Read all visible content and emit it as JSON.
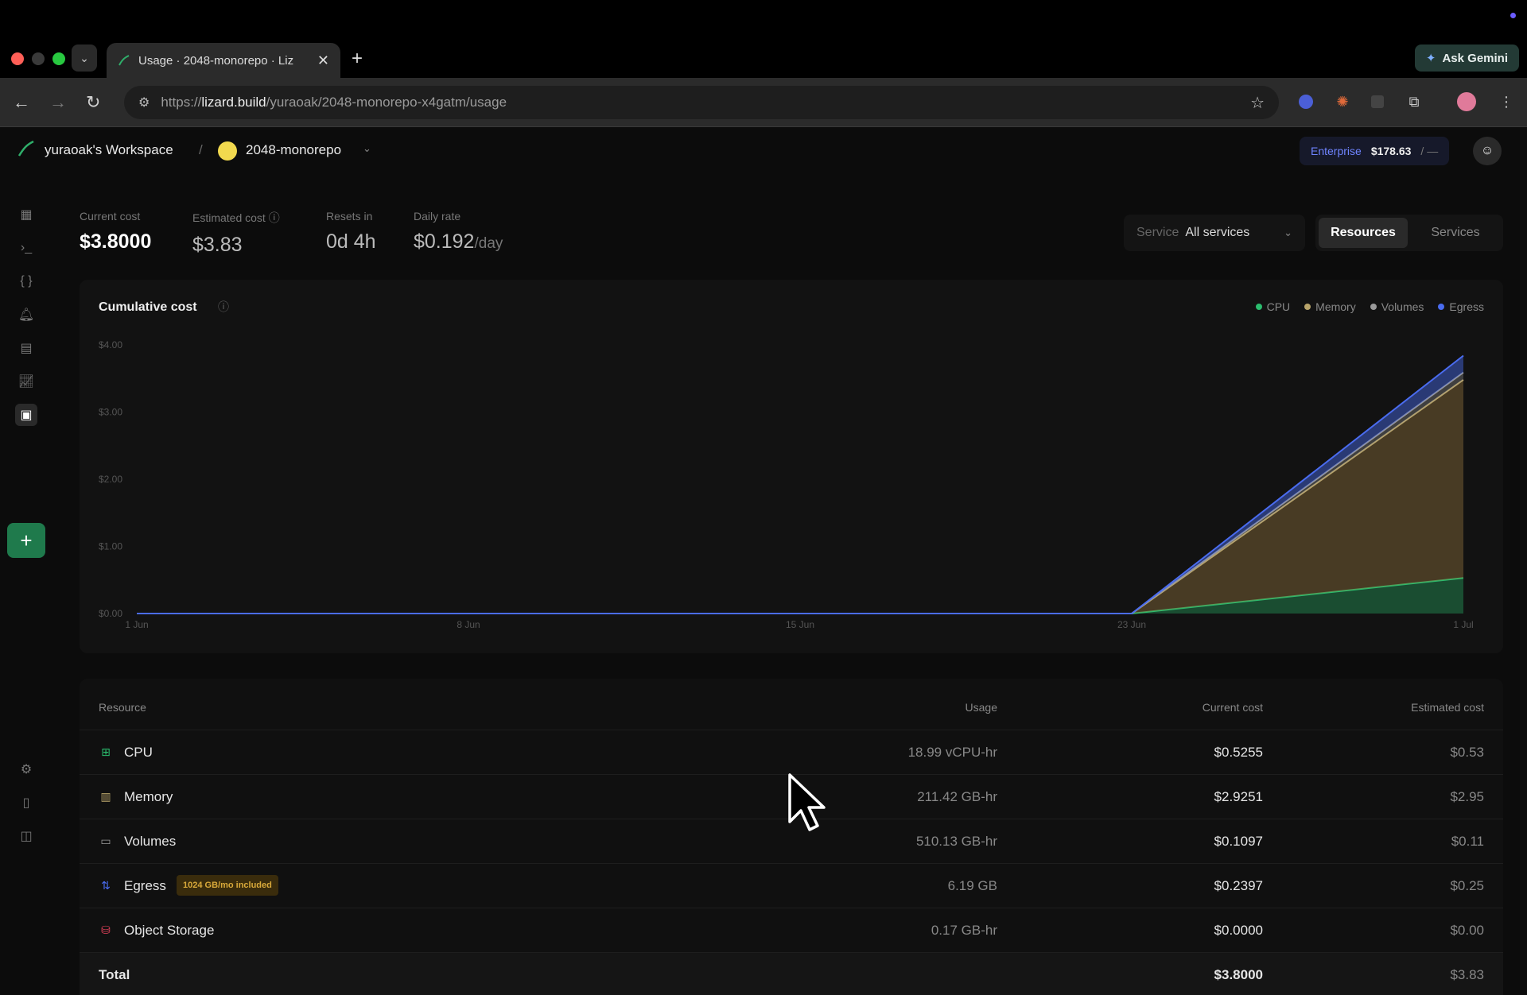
{
  "browser": {
    "tab_title": "Usage · 2048-monorepo · Liz",
    "url_prefix": "https://",
    "url_host": "lizard.build",
    "url_path": "/yuraoak/2048-monorepo-x4gatm/usage",
    "gemini_label": "Ask Gemini"
  },
  "header": {
    "workspace": "yuraoak's Workspace",
    "separator": "/",
    "project": "2048-monorepo",
    "plan_tier": "Enterprise",
    "plan_cost": "$178.63",
    "plan_limit": "/ —"
  },
  "stats": {
    "current_cost_label": "Current cost",
    "current_cost": "$3.8000",
    "estimated_cost_label": "Estimated cost",
    "estimated_cost": "$3.83",
    "resets_label": "Resets in",
    "resets": "0d 4h",
    "daily_label": "Daily rate",
    "daily": "$0.192",
    "daily_unit": "/day"
  },
  "filters": {
    "service_label": "Service",
    "service_value": "All services",
    "toggle": [
      "Resources",
      "Services"
    ],
    "toggle_active": "Resources"
  },
  "chart": {
    "title": "Cumulative cost",
    "legend": [
      {
        "name": "CPU",
        "color": "#2bbd6e"
      },
      {
        "name": "Memory",
        "color": "#b8a46a"
      },
      {
        "name": "Volumes",
        "color": "#9a9a9a"
      },
      {
        "name": "Egress",
        "color": "#4a6cf0"
      }
    ]
  },
  "chart_data": {
    "type": "area",
    "stacked": true,
    "title": "Cumulative cost",
    "x": [
      "1 Jun",
      "8 Jun",
      "15 Jun",
      "23 Jun",
      "1 Jul"
    ],
    "x_ticks": [
      "1 Jun",
      "8 Jun",
      "15 Jun",
      "23 Jun",
      "1 Jul"
    ],
    "y_ticks": [
      "$0.00",
      "$1.00",
      "$2.00",
      "$3.00",
      "$4.00"
    ],
    "ylim": [
      0,
      4
    ],
    "series": [
      {
        "name": "CPU",
        "color": "#2bbd6e",
        "values": [
          0,
          0,
          0,
          0,
          0.53
        ]
      },
      {
        "name": "Memory",
        "color": "#b8a46a",
        "values": [
          0,
          0,
          0,
          0,
          2.95
        ]
      },
      {
        "name": "Volumes",
        "color": "#9a9a9a",
        "values": [
          0,
          0,
          0,
          0,
          0.11
        ]
      },
      {
        "name": "Egress",
        "color": "#4a6cf0",
        "values": [
          0,
          0,
          0,
          0,
          0.25
        ]
      }
    ],
    "legend_position": "top-right",
    "grid": false
  },
  "table": {
    "headers": [
      "Resource",
      "Usage",
      "Current cost",
      "Estimated cost"
    ],
    "rows": [
      {
        "name": "CPU",
        "usage": "18.99 vCPU-hr",
        "current": "$0.5255",
        "estimated": "$0.53",
        "icon": "cpu-icon",
        "color": "#2bbd6e"
      },
      {
        "name": "Memory",
        "usage": "211.42 GB-hr",
        "current": "$2.9251",
        "estimated": "$2.95",
        "icon": "memory-icon",
        "color": "#b8a46a"
      },
      {
        "name": "Volumes",
        "usage": "510.13 GB-hr",
        "current": "$0.1097",
        "estimated": "$0.11",
        "icon": "volume-icon",
        "color": "#9a9a9a"
      },
      {
        "name": "Egress",
        "usage": "6.19 GB",
        "current": "$0.2397",
        "estimated": "$0.25",
        "icon": "egress-icon",
        "color": "#4a6cf0",
        "badge": "1024 GB/mo included"
      },
      {
        "name": "Object Storage",
        "usage": "0.17 GB-hr",
        "current": "$0.0000",
        "estimated": "$0.00",
        "icon": "bucket-icon",
        "color": "#e0415a"
      }
    ],
    "total": {
      "name": "Total",
      "current": "$3.8000",
      "estimated": "$3.83"
    }
  }
}
